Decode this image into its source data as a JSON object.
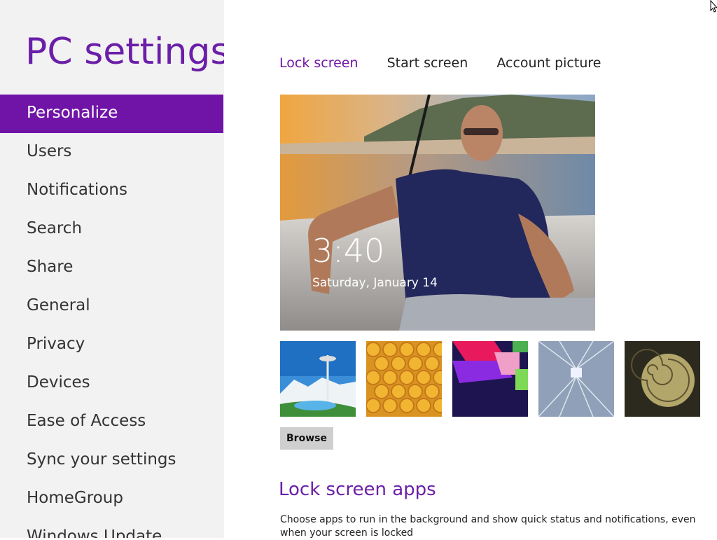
{
  "app": {
    "title": "PC settings"
  },
  "sidebar": {
    "items": [
      {
        "label": "Personalize",
        "active": true
      },
      {
        "label": "Users"
      },
      {
        "label": "Notifications"
      },
      {
        "label": "Search"
      },
      {
        "label": "Share"
      },
      {
        "label": "General"
      },
      {
        "label": "Privacy"
      },
      {
        "label": "Devices"
      },
      {
        "label": "Ease of Access"
      },
      {
        "label": "Sync your settings"
      },
      {
        "label": "HomeGroup"
      },
      {
        "label": "Windows Update"
      }
    ]
  },
  "tabs": [
    {
      "label": "Lock screen",
      "active": true
    },
    {
      "label": "Start screen"
    },
    {
      "label": "Account picture"
    }
  ],
  "lock_preview": {
    "time": "3:40",
    "date": "Saturday, January 14"
  },
  "thumbnails": [
    {
      "name": "space-needle-thumbnail"
    },
    {
      "name": "honeycomb-thumbnail"
    },
    {
      "name": "geometric-shapes-thumbnail"
    },
    {
      "name": "tunnel-lights-thumbnail"
    },
    {
      "name": "nautilus-shell-thumbnail"
    }
  ],
  "browse_label": "Browse",
  "lock_apps": {
    "heading": "Lock screen apps",
    "description": "Choose apps to run in the background and show quick status and notifications, even when your screen is locked"
  },
  "colors": {
    "accent": "#7014a8",
    "sidebar_bg": "#f2f2f2"
  }
}
